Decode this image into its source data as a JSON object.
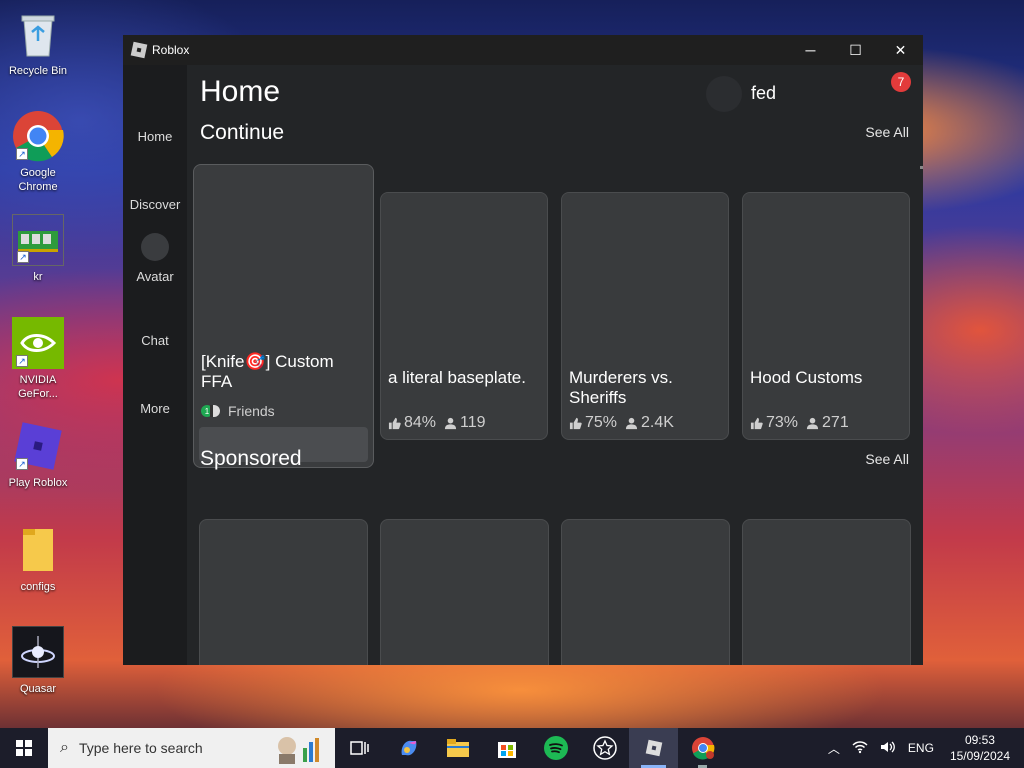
{
  "desktop": {
    "icons": [
      {
        "label": "Recycle Bin"
      },
      {
        "label": "Google Chrome"
      },
      {
        "label": "kr"
      },
      {
        "label": "NVIDIA GeFor..."
      },
      {
        "label": "Play Roblox"
      },
      {
        "label": "configs"
      },
      {
        "label": "Quasar"
      }
    ]
  },
  "window": {
    "title": "Roblox",
    "controls": {
      "minimize": "─",
      "maximize": "☐",
      "close": "✕"
    }
  },
  "sidebar": {
    "items": [
      {
        "label": "Home"
      },
      {
        "label": "Discover"
      },
      {
        "label": "Avatar"
      },
      {
        "label": "Chat"
      },
      {
        "label": "More"
      }
    ]
  },
  "header": {
    "title": "Home",
    "username": "fed",
    "notification_count": "7"
  },
  "continue_section": {
    "title": "Continue",
    "see_all": "See All",
    "featured": {
      "name": "[Knife🎯] Custom FFA",
      "friends_count": "1",
      "friends_label": "Friends"
    },
    "games": [
      {
        "name": "a literal baseplate.",
        "rating": "84%",
        "players": "119"
      },
      {
        "name": "Murderers vs. Sheriffs",
        "rating": "75%",
        "players": "2.4K"
      },
      {
        "name": "Hood Customs",
        "rating": "73%",
        "players": "271"
      }
    ]
  },
  "sponsored_section": {
    "title": "Sponsored",
    "see_all": "See All"
  },
  "taskbar": {
    "search_placeholder": "Type here to search",
    "language": "ENG",
    "time": "09:53",
    "date": "15/09/2024"
  },
  "colors": {
    "window_bg": "#232527",
    "sidebar_bg": "#1b1c1e",
    "card_bg": "#393b3d",
    "badge_red": "#e23b3b",
    "friend_green": "#1fa852"
  }
}
